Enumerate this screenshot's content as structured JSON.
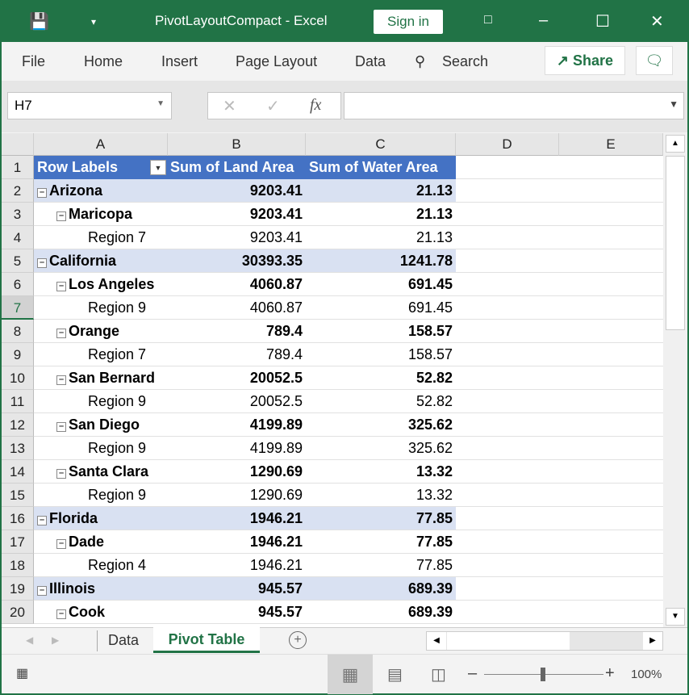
{
  "title": {
    "doc": "PivotLayoutCompact  -  Excel",
    "sign_in": "Sign in"
  },
  "menu": {
    "items": [
      "File",
      "Home",
      "Insert",
      "Page Layout",
      "Data"
    ],
    "search": "Search",
    "share": "Share"
  },
  "formula": {
    "name_box": "H7",
    "value": ""
  },
  "columns": [
    "A",
    "B",
    "C",
    "D",
    "E"
  ],
  "pivot": {
    "headers": [
      "Row Labels",
      "Sum of Land Area",
      "Sum of Water Area"
    ],
    "rows": [
      {
        "label": "Arizona",
        "land": "9203.41",
        "water": "21.13",
        "level": 0
      },
      {
        "label": "Maricopa",
        "land": "9203.41",
        "water": "21.13",
        "level": 1
      },
      {
        "label": "Region 7",
        "land": "9203.41",
        "water": "21.13",
        "level": 2
      },
      {
        "label": "California",
        "land": "30393.35",
        "water": "1241.78",
        "level": 0
      },
      {
        "label": "Los Angeles",
        "land": "4060.87",
        "water": "691.45",
        "level": 1
      },
      {
        "label": "Region 9",
        "land": "4060.87",
        "water": "691.45",
        "level": 2
      },
      {
        "label": "Orange",
        "land": "789.4",
        "water": "158.57",
        "level": 1
      },
      {
        "label": "Region 7",
        "land": "789.4",
        "water": "158.57",
        "level": 2
      },
      {
        "label": "San Bernard",
        "land": "20052.5",
        "water": "52.82",
        "level": 1
      },
      {
        "label": "Region 9",
        "land": "20052.5",
        "water": "52.82",
        "level": 2
      },
      {
        "label": "San Diego",
        "land": "4199.89",
        "water": "325.62",
        "level": 1
      },
      {
        "label": "Region 9",
        "land": "4199.89",
        "water": "325.62",
        "level": 2
      },
      {
        "label": "Santa Clara",
        "land": "1290.69",
        "water": "13.32",
        "level": 1
      },
      {
        "label": "Region 9",
        "land": "1290.69",
        "water": "13.32",
        "level": 2
      },
      {
        "label": "Florida",
        "land": "1946.21",
        "water": "77.85",
        "level": 0
      },
      {
        "label": "Dade",
        "land": "1946.21",
        "water": "77.85",
        "level": 1
      },
      {
        "label": "Region 4",
        "land": "1946.21",
        "water": "77.85",
        "level": 2
      },
      {
        "label": "Illinois",
        "land": "945.57",
        "water": "689.39",
        "level": 0
      },
      {
        "label": "Cook",
        "land": "945.57",
        "water": "689.39",
        "level": 1
      }
    ]
  },
  "sheets": {
    "tabs": [
      "Data",
      "Pivot Table"
    ],
    "active": "Pivot Table"
  },
  "status": {
    "zoom": "100%",
    "zoom_fraction": 0.5
  },
  "colors": {
    "brand": "#217346",
    "pivot_header": "#4472c4",
    "pivot_subtotal": "#d9e1f2"
  }
}
